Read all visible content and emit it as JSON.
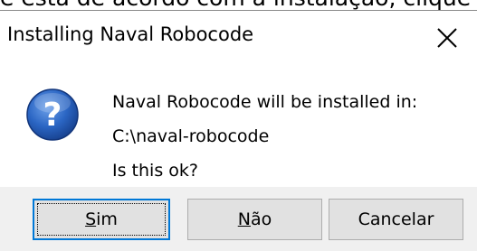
{
  "background_text": "e está de acordo com a instalação, clique",
  "dialog": {
    "title": "Installing Naval Robocode",
    "close_glyph": "✕",
    "icon": "question-icon",
    "message_line1": "Naval Robocode will be installed in:",
    "message_line2": "C:\\naval-robocode",
    "message_line3": "Is this ok?"
  },
  "buttons": {
    "yes": {
      "label": "Sim",
      "mnemonic": "S",
      "rest": "im"
    },
    "no": {
      "label": "Não",
      "mnemonic": "N",
      "rest": "ão"
    },
    "cancel": {
      "label": "Cancelar"
    }
  },
  "colors": {
    "dialog_bg": "#f0f0f0",
    "content_bg": "#ffffff",
    "focus_border": "#0078d7",
    "button_bg": "#e1e1e1",
    "icon_blue": "#1f5fbf"
  }
}
